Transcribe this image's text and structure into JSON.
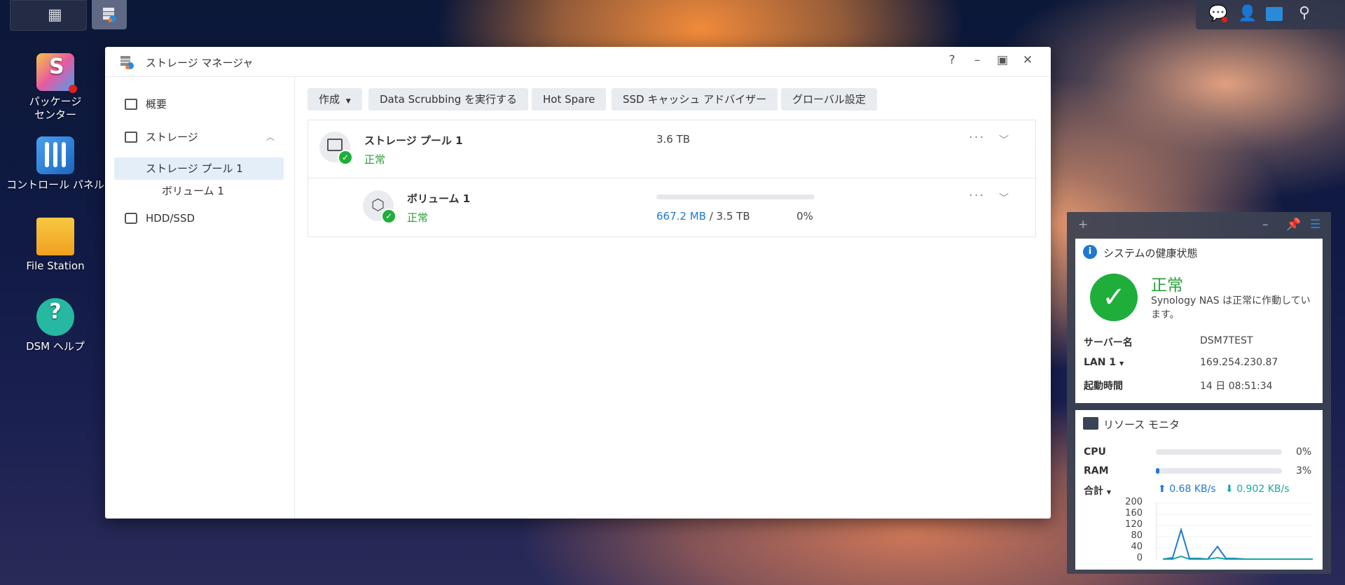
{
  "desktop": {
    "icons": [
      {
        "label": "パッケージ\nセンター"
      },
      {
        "label": "コントロール パネル"
      },
      {
        "label": "File Station"
      },
      {
        "label": "DSM ヘルプ"
      }
    ]
  },
  "window": {
    "title": "ストレージ マネージャ",
    "controls": {
      "help": "?",
      "minimize": "–",
      "maximize": "▣",
      "close": "✕"
    }
  },
  "sidebar": {
    "overview": "概要",
    "storage": "ストレージ",
    "pool": "ストレージ プール 1",
    "volume": "ボリューム 1",
    "hdd": "HDD/SSD"
  },
  "toolbar": {
    "create": "作成",
    "scrub": "Data Scrubbing を実行する",
    "hotspare": "Hot Spare",
    "ssd": "SSD キャッシュ アドバイザー",
    "global": "グローバル設定"
  },
  "pool": {
    "name": "ストレージ プール 1",
    "status": "正常",
    "size": "3.6 TB"
  },
  "volume": {
    "name": "ボリューム 1",
    "status": "正常",
    "used": "667.2 MB",
    "separator": " / ",
    "total": "3.5 TB",
    "percent": "0%",
    "usage_fraction": 0.0
  },
  "health": {
    "title": "システムの健康状態",
    "state": "正常",
    "message": "Synology NAS は正常に作動しています。",
    "server_label": "サーバー名",
    "server_value": "DSM7TEST",
    "lan_label": "LAN 1",
    "lan_value": "169.254.230.87",
    "uptime_label": "起動時間",
    "uptime_value": "14 日 08:51:34"
  },
  "monitor": {
    "title": "リソース モニタ",
    "cpu_label": "CPU",
    "cpu_pct": "0%",
    "cpu_fraction": 0.0,
    "ram_label": "RAM",
    "ram_pct": "3%",
    "ram_fraction": 0.03,
    "total_label": "合計",
    "up": "0.68 KB/s",
    "down": "0.902 KB/s",
    "y_ticks": [
      "200",
      "160",
      "120",
      "80",
      "40",
      "0"
    ]
  },
  "colors": {
    "ok_green": "#27a236",
    "link_blue": "#1f78d1",
    "up_blue": "#1f78d1",
    "down_teal": "#1aa7a0"
  }
}
